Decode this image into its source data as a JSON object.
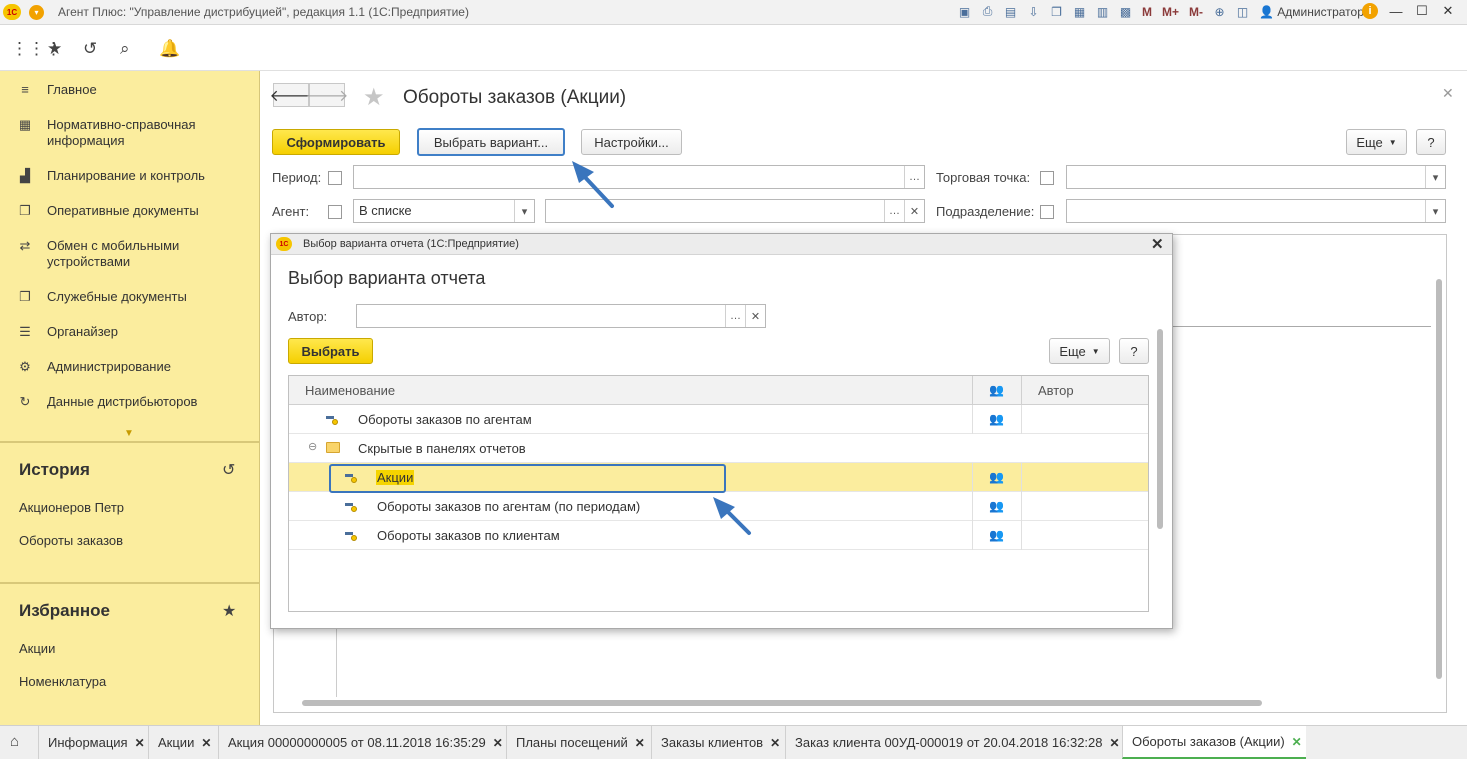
{
  "window": {
    "title": "Агент Плюс: \"Управление дистрибуцией\", редакция 1.1  (1С:Предприятие)",
    "user": "Администратор",
    "logo": "1С",
    "m_buttons": [
      "M",
      "M+",
      "M-"
    ]
  },
  "sidebar": {
    "items": [
      {
        "label": "Главное",
        "icon": "hamburger-icon"
      },
      {
        "label": "Нормативно-справочная информация",
        "icon": "grid-icon"
      },
      {
        "label": "Планирование и контроль",
        "icon": "bar-chart-icon"
      },
      {
        "label": "Оперативные документы",
        "icon": "documents-icon"
      },
      {
        "label": "Обмен с мобильными устройствами",
        "icon": "sync-icon"
      },
      {
        "label": "Служебные документы",
        "icon": "documents-icon"
      },
      {
        "label": "Органайзер",
        "icon": "list-icon"
      },
      {
        "label": "Администрирование",
        "icon": "gear-icon"
      },
      {
        "label": "Данные дистрибьюторов",
        "icon": "refresh-icon"
      }
    ],
    "history": {
      "title": "История",
      "items": [
        "Акционеров Петр",
        "Обороты заказов"
      ]
    },
    "favorites": {
      "title": "Избранное",
      "items": [
        "Акции",
        "Номенклатура"
      ]
    }
  },
  "form": {
    "title": "Обороты заказов (Акции)",
    "generate_label": "Сформировать",
    "choose_variant_label": "Выбрать вариант...",
    "settings_label": "Настройки...",
    "more_label": "Еще",
    "help_label": "?",
    "period_label": "Период:",
    "agent_label": "Агент:",
    "agent_mode_value": "В списке",
    "trade_point_label": "Торговая точка:",
    "division_label": "Подразделение:"
  },
  "dialog": {
    "window_title": "Выбор варианта отчета  (1С:Предприятие)",
    "heading": "Выбор варианта отчета",
    "author_label": "Автор:",
    "select_label": "Выбрать",
    "more_label": "Еще",
    "help_label": "?",
    "columns": {
      "name": "Наименование",
      "author": "Автор"
    },
    "rows": [
      {
        "name": "Обороты заказов по агентам",
        "indent": 0,
        "type": "report"
      },
      {
        "name": "Скрытые в панелях отчетов",
        "indent": 0,
        "type": "group"
      },
      {
        "name": "Акции",
        "indent": 1,
        "type": "report",
        "selected": true
      },
      {
        "name": "Обороты заказов по агентам (по периодам)",
        "indent": 1,
        "type": "report"
      },
      {
        "name": "Обороты заказов по клиентам",
        "indent": 1,
        "type": "report"
      }
    ]
  },
  "taskbar": {
    "tabs": [
      "Информация",
      "Акции",
      "Акция 00000000005 от 08.11.2018 16:35:29",
      "Планы посещений",
      "Заказы клиентов",
      "Заказ клиента 00УД-000019 от 20.04.2018 16:32:28",
      "Обороты заказов (Акции)"
    ],
    "active_index": 6
  },
  "colors": {
    "sidebar_bg": "#fbed9e",
    "accent_yellow": "#f5cf00",
    "highlight_blue": "#3a75bd",
    "active_tab": "#4caf50"
  }
}
